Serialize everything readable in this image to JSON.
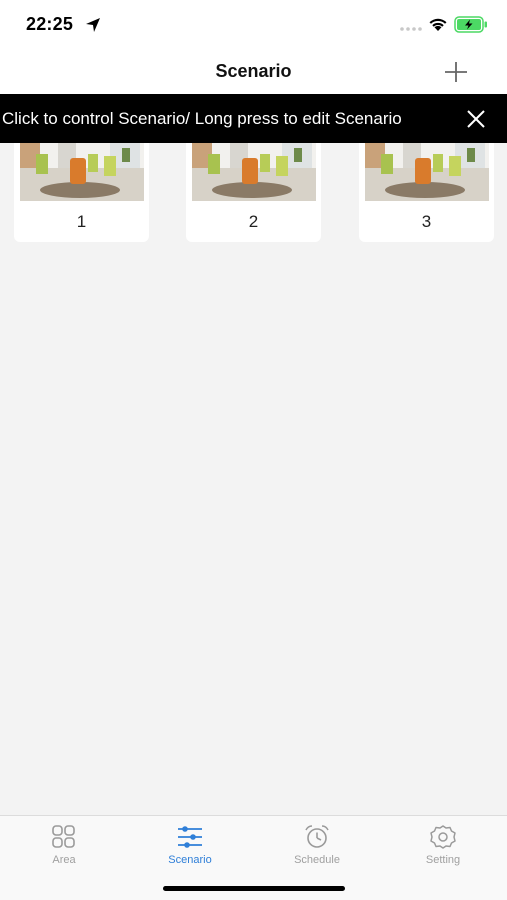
{
  "status": {
    "time": "22:25"
  },
  "header": {
    "title": "Scenario"
  },
  "banner": {
    "text": "Click to control Scenario/ Long press to edit Scenario"
  },
  "scenarios": [
    {
      "label": "1"
    },
    {
      "label": "2"
    },
    {
      "label": "3"
    }
  ],
  "tabs": [
    {
      "label": "Area",
      "icon": "grid-icon",
      "active": false
    },
    {
      "label": "Scenario",
      "icon": "sliders-icon",
      "active": true
    },
    {
      "label": "Schedule",
      "icon": "alarm-clock-icon",
      "active": false
    },
    {
      "label": "Setting",
      "icon": "gear-icon",
      "active": false
    }
  ],
  "colors": {
    "accent": "#2f7fd8",
    "banner_bg": "#000000",
    "background": "#f3f3f3",
    "battery": "#4cd964"
  }
}
